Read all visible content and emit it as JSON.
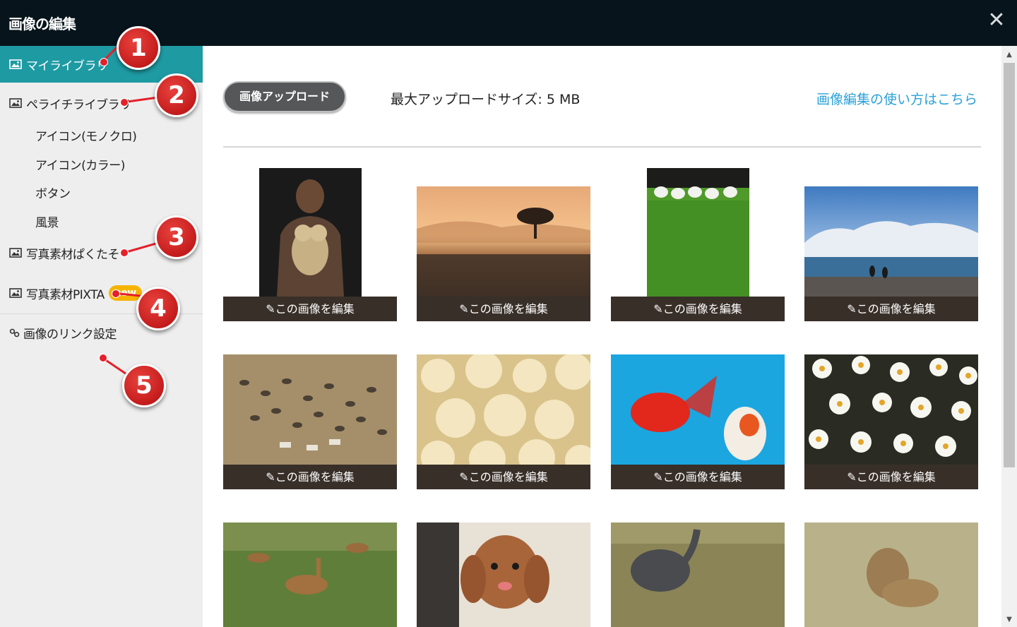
{
  "window": {
    "title": "画像の編集",
    "close_label": "✕"
  },
  "sidebar": {
    "my_library": "マイライブラリ",
    "peraichi_library": "ペライチライブラリ",
    "sub_items": [
      "アイコン(モノクロ)",
      "アイコン(カラー)",
      "ボタン",
      "風景"
    ],
    "photo_pakutaso": "写真素材ぱくたそ",
    "photo_pixta": "写真素材PIXTA",
    "pixta_badge": "new",
    "link_settings": "画像のリンク設定"
  },
  "main": {
    "upload_button": "画像アップロード",
    "max_upload_size": "最大アップロードサイズ: 5 MB",
    "help_link": "画像編集の使い方はこちら",
    "edit_label": "この画像を編集"
  },
  "images": [
    {
      "subject": "man holding poodle",
      "colors": [
        "#1a1a1a",
        "#5c4334"
      ]
    },
    {
      "subject": "savanna sunset with tree",
      "colors": [
        "#f2b27a",
        "#3c2c22"
      ]
    },
    {
      "subject": "geese on grass",
      "colors": [
        "#1c1c1a",
        "#4f9a2a"
      ]
    },
    {
      "subject": "penguins and icebergs",
      "colors": [
        "#5a87c4",
        "#e9eef4"
      ]
    },
    {
      "subject": "wildebeest and zebra herd",
      "colors": [
        "#a58f6a",
        "#52483a"
      ]
    },
    {
      "subject": "chicks",
      "colors": [
        "#f3e6c0",
        "#d9c38b"
      ]
    },
    {
      "subject": "goldfish",
      "colors": [
        "#1ba6e0",
        "#e2271d"
      ]
    },
    {
      "subject": "daisies",
      "colors": [
        "#2a2b22",
        "#f7f7f2"
      ]
    },
    {
      "subject": "impala",
      "colors": [
        "#5f7e39",
        "#a2713f"
      ]
    },
    {
      "subject": "toy poodle",
      "colors": [
        "#a8653a",
        "#e8e1d6"
      ]
    },
    {
      "subject": "baby elephant in grass",
      "colors": [
        "#8a8457",
        "#4a4b4f"
      ]
    },
    {
      "subject": "lion in grass",
      "colors": [
        "#b9b18a",
        "#9c7c52"
      ]
    }
  ],
  "annotations": [
    "1",
    "2",
    "3",
    "4",
    "5"
  ],
  "colors": {
    "accent": "#1e9aa3",
    "link": "#2aa1d9",
    "titlebar": "#07141b",
    "edit_bar": "#382f28",
    "marker": "#d42424"
  }
}
